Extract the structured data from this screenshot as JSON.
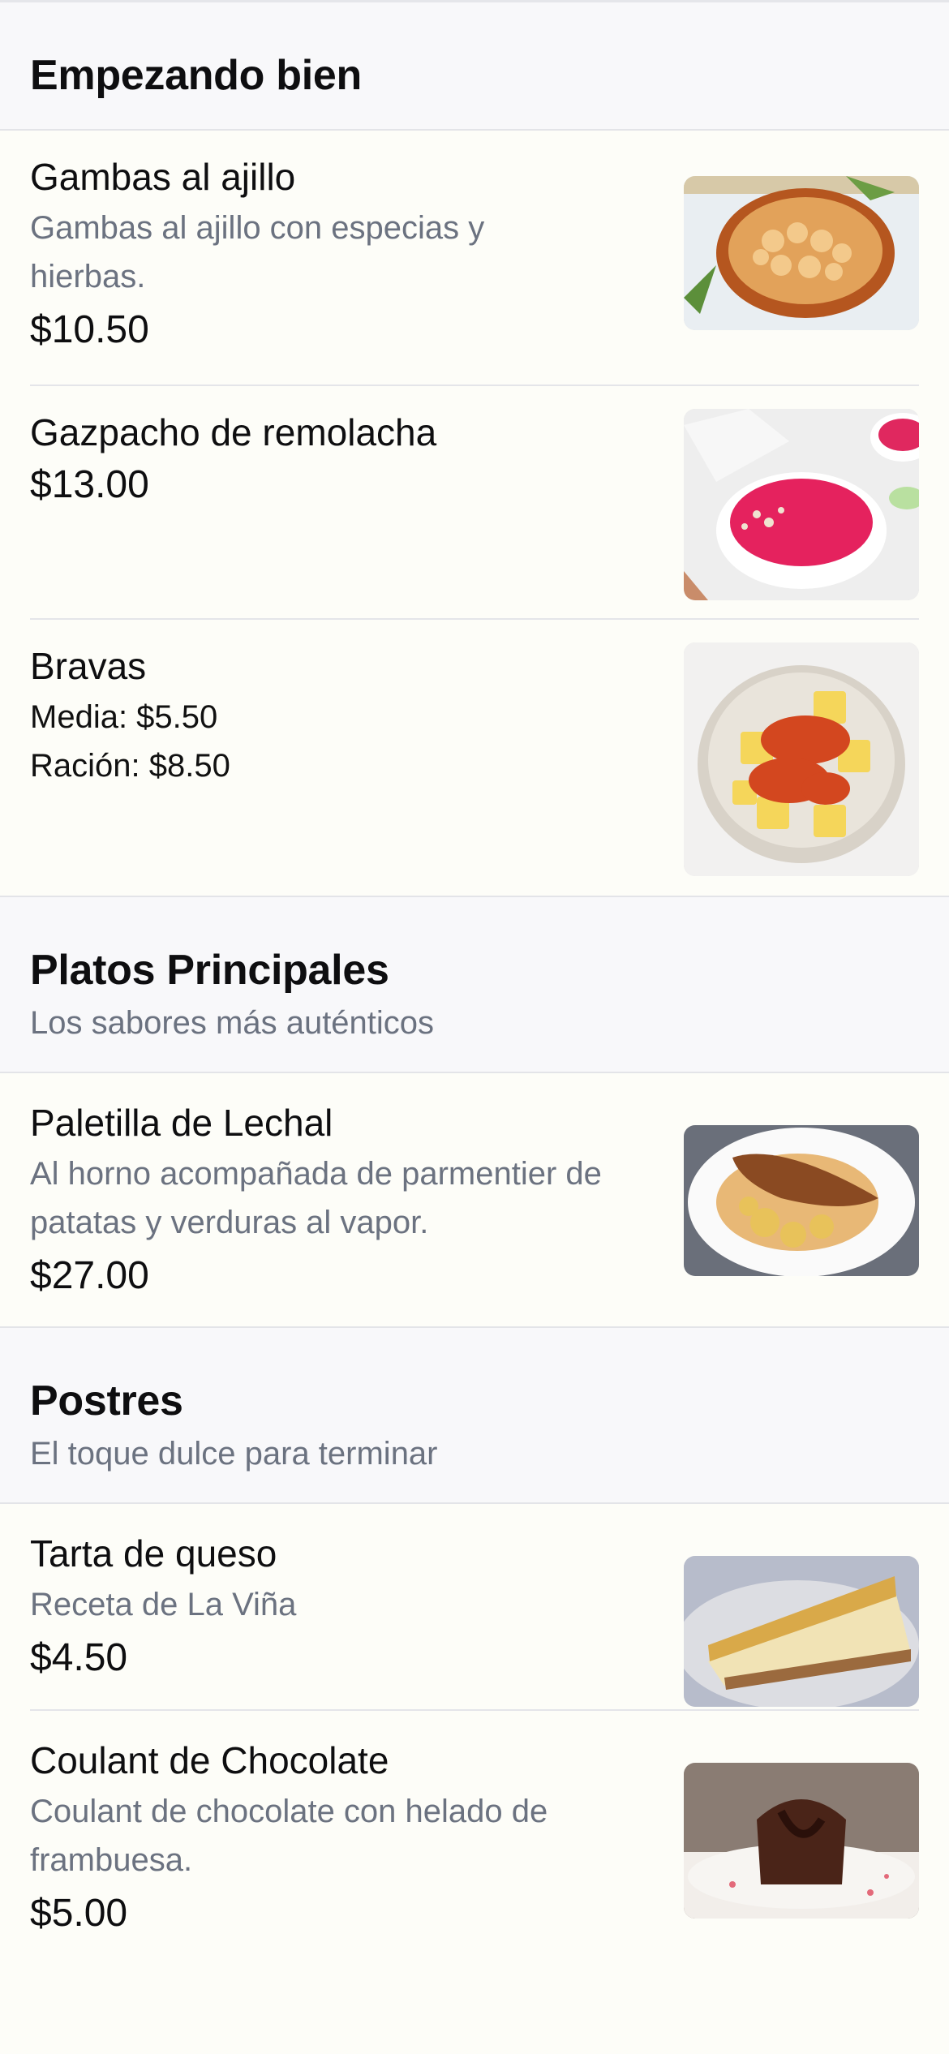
{
  "sections": [
    {
      "title": "Empezando bien",
      "subtitle": "",
      "items": [
        {
          "name": "Gambas al ajillo",
          "description": "Gambas al ajillo con especias y hierbas.",
          "price": "$10.50",
          "image": "gambas-photo"
        },
        {
          "name": "Gazpacho de remolacha",
          "description": "",
          "price": "$13.00",
          "image": "gazpacho-photo"
        },
        {
          "name": "Bravas",
          "variants": [
            "Media: $5.50",
            "Ración: $8.50"
          ],
          "image": "bravas-photo"
        }
      ]
    },
    {
      "title": "Platos Principales",
      "subtitle": "Los sabores más auténticos",
      "items": [
        {
          "name": "Paletilla de Lechal",
          "description": "Al horno acompañada de parmentier de patatas y verduras al vapor.",
          "price": "$27.00",
          "image": "paletilla-photo"
        }
      ]
    },
    {
      "title": "Postres",
      "subtitle": "El toque dulce para terminar",
      "items": [
        {
          "name": "Tarta de queso",
          "description": "Receta de La Viña",
          "price": "$4.50",
          "image": "tarta-photo"
        },
        {
          "name": "Coulant de Chocolate",
          "description": "Coulant de chocolate con helado de frambuesa.",
          "price": "$5.00",
          "image": "coulant-photo"
        }
      ]
    }
  ]
}
